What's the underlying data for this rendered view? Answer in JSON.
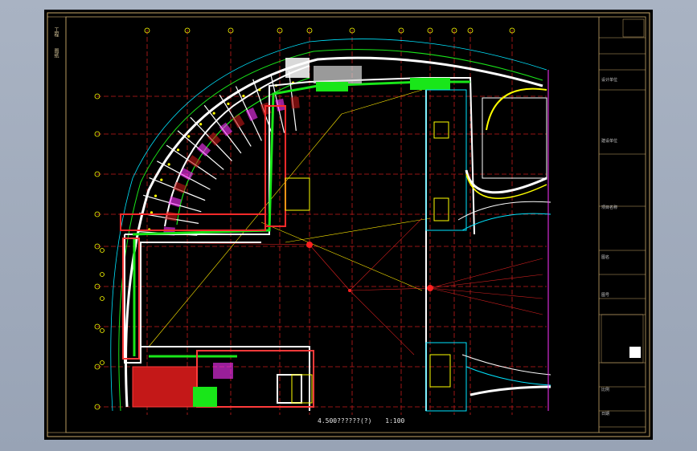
{
  "drawing": {
    "caption_title": "4.500??????(?)",
    "caption_scale": "1:100"
  },
  "left_strip": {
    "label_top": "工程",
    "label_mid": "图纸"
  },
  "title_block": {
    "rows": [
      "设计单位",
      "建设单位",
      "项目名称",
      "图名",
      "图号",
      "比例",
      "日期"
    ]
  },
  "colors": {
    "frame": "#c9a86a",
    "grid": "#d22",
    "wall": "#ffffff",
    "green": "#19e619",
    "yellow": "#ffff00",
    "cyan": "#00e5ff",
    "magenta": "#ff33ff"
  }
}
